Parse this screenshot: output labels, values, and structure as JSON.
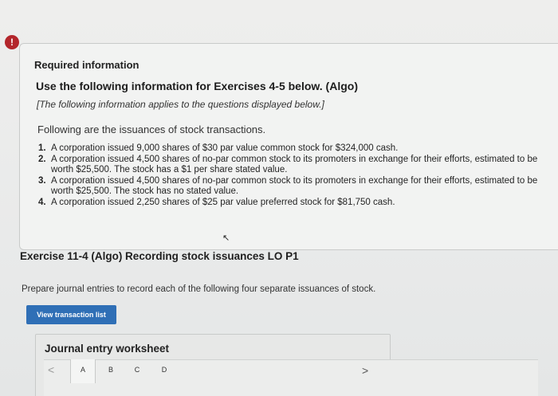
{
  "alert": {
    "icon": "exclamation-icon",
    "glyph": "!",
    "color": "#b3262b"
  },
  "info": {
    "required_label": "Required information",
    "use_title": "Use the following information for Exercises 4-5 below. (Algo)",
    "applies_note": "[The following information applies to the questions displayed below.]",
    "following_text": "Following are the issuances of stock transactions.",
    "transactions": [
      {
        "num": "1.",
        "text": "A corporation issued 9,000 shares of $30 par value common stock for $324,000 cash."
      },
      {
        "num": "2.",
        "text": "A corporation issued 4,500 shares of no-par common stock to its promoters in exchange for their efforts, estimated to be worth $25,500. The stock has a $1 per share stated value."
      },
      {
        "num": "3.",
        "text": "A corporation issued 4,500 shares of no-par common stock to its promoters in exchange for their efforts, estimated to be worth $25,500. The stock has no stated value."
      },
      {
        "num": "4.",
        "text": "A corporation issued 2,250 shares of $25 par value preferred stock for $81,750 cash."
      }
    ]
  },
  "exercise": {
    "title": "Exercise 11-4 (Algo) Recording stock issuances LO P1",
    "instruction": "Prepare journal entries to record each of the following four separate issuances of stock.",
    "view_button_label": "View transaction list",
    "accent_color": "#2f6fb6"
  },
  "worksheet": {
    "title": "Journal entry worksheet",
    "prev_glyph": "<",
    "next_glyph": ">",
    "tabs": [
      "A",
      "B",
      "C",
      "D"
    ],
    "active_tab": "A"
  }
}
